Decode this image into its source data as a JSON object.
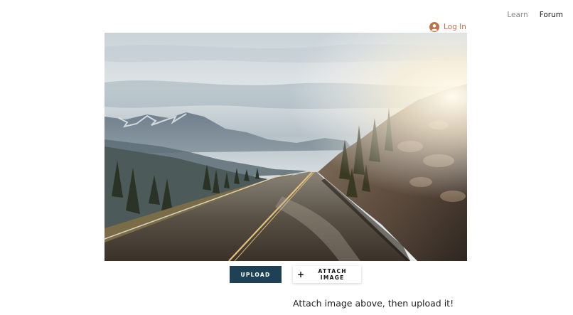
{
  "nav": {
    "learn_label": "Learn",
    "forum_label": "Forum"
  },
  "auth": {
    "login_label": "Log In",
    "login_icon": "user-avatar-icon"
  },
  "hero_image": {
    "description_icon": "mountain-road-photo"
  },
  "actions": {
    "upload_label": "UPLOAD",
    "attach_label": "ATTACH IMAGE",
    "attach_icon": "plus-icon"
  },
  "helper_text": "Attach image above, then upload it!",
  "colors": {
    "login_accent": "#c0714a",
    "upload_bg": "#1f4156",
    "nav_muted": "#8a8a8a",
    "nav_dark": "#1a1a1a"
  }
}
